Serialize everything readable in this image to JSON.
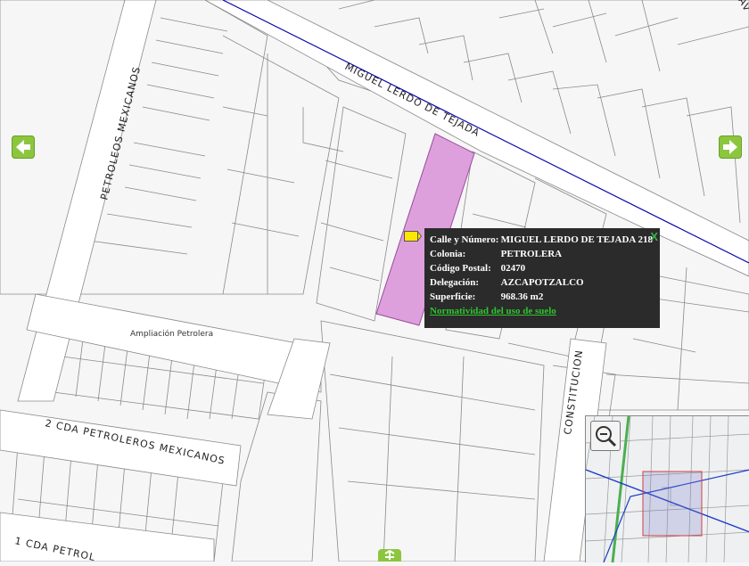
{
  "streets": {
    "lerdo": "MIGUEL LERDO DE TEJADA",
    "petroleos": "PETROLEOS MEXICANOS",
    "cda2": "2 CDA PETROLEROS MEXICANOS",
    "cda1": "1 CDA PETROL",
    "constitucion": "CONSTITUCION",
    "corner": "AV"
  },
  "area_label": "Ampliación Petrolera",
  "popup": {
    "rows": [
      {
        "key": "Calle y Número:",
        "value": "MIGUEL LERDO DE TEJADA 218"
      },
      {
        "key": "Colonia:",
        "value": "PETROLERA"
      },
      {
        "key": "Código Postal:",
        "value": "02470"
      },
      {
        "key": "Delegación:",
        "value": "AZCAPOTZALCO"
      },
      {
        "key": "Superficie:",
        "value": "968.36 m2"
      }
    ],
    "link": "Normatividad del uso de suelo",
    "close": "X"
  },
  "colors": {
    "parcel_fill": "#dda0dd",
    "street_line": "#0000aa",
    "nav_green": "#8cc63f",
    "popup_bg": "#2b2b2b",
    "link_green": "#2ec52e"
  },
  "icons": {
    "pan_left": "arrow-left-icon",
    "pan_right": "arrow-right-icon",
    "pan_down": "arrow-down-icon",
    "zoom": "zoom-out-icon",
    "marker": "marker-tag-icon"
  }
}
